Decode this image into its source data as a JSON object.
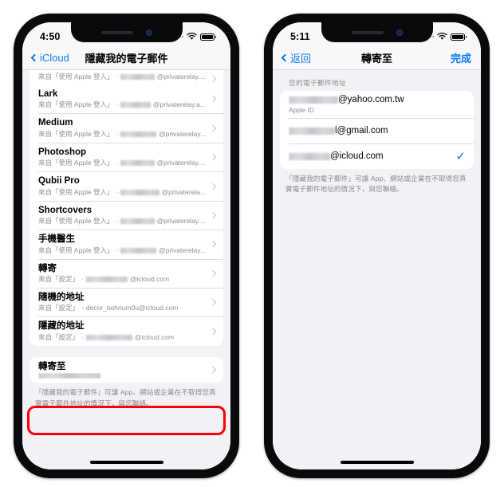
{
  "meta": {
    "accent_blue": "#0a7cff",
    "highlight_red": "#fb0007",
    "bg": "#ffffff"
  },
  "left_phone": {
    "status": {
      "time": "4:50",
      "signal": "cellular-dots-icon",
      "wifi": "wifi-icon",
      "battery": "battery-icon"
    },
    "nav": {
      "back_label": "iCloud",
      "title": "隱藏我的電子郵件"
    },
    "partial_row": {
      "sub_prefix": "來自「使用 Apple 登入」",
      "sub_sep": "·",
      "sub_domain": "@privaterelay...."
    },
    "rows": [
      {
        "title": "Lark",
        "sub_prefix": "來自「使用 Apple 登入」",
        "sub_sep": "·",
        "blur_w": 58,
        "sub_domain": "@privaterelay.a..."
      },
      {
        "title": "Medium",
        "sub_prefix": "來自「使用 Apple 登入」",
        "sub_sep": "·",
        "blur_w": 58,
        "sub_domain": "@privaterelay..."
      },
      {
        "title": "Photoshop",
        "sub_prefix": "來自「使用 Apple 登入」",
        "sub_sep": "·",
        "blur_w": 54,
        "sub_domain": "@privaterelay...."
      },
      {
        "title": "Qubii Pro",
        "sub_prefix": "來自「使用 Apple 登入」",
        "sub_sep": "·",
        "blur_w": 60,
        "sub_domain": "@privaterela..."
      },
      {
        "title": "Shortcovers",
        "sub_prefix": "來自「使用 Apple 登入」",
        "sub_sep": "·",
        "blur_w": 56,
        "sub_domain": "@privaterelay...."
      },
      {
        "title": "手機醫生",
        "sub_prefix": "來自「使用 Apple 登入」",
        "sub_sep": "·",
        "blur_w": 50,
        "sub_domain": "@privaterelay..."
      },
      {
        "title": "轉寄",
        "sub_prefix": "來自「設定」",
        "sub_sep": "·",
        "blur_w": 52,
        "sub_domain": "@icloud.com"
      },
      {
        "title": "隨機的地址",
        "sub_prefix": "來自「設定」",
        "sub_sep": "·",
        "blur_w": 0,
        "sub_domain": "decor_bohrium0u@icloud.com"
      },
      {
        "title": "隱藏的地址",
        "sub_prefix": "來自「設定」",
        "sub_sep": "·",
        "blur_w": 58,
        "sub_domain": "@icloud.com"
      }
    ],
    "highlighted_row": {
      "title": "轉寄至",
      "blur_w": 78
    },
    "footnote": "「隱藏我的電子郵件」可讓 App、網站或企業在不取得您真實電子郵件地址的情況下，與您聯絡。"
  },
  "right_phone": {
    "status": {
      "time": "5:11",
      "signal": "cellular-dots-icon",
      "wifi": "wifi-icon",
      "battery": "battery-icon"
    },
    "nav": {
      "back_label": "返回",
      "title": "轉寄至",
      "done_label": "完成"
    },
    "section_header": "您的電子郵件地址",
    "emails": [
      {
        "blur_w": 62,
        "domain": "@yahoo.com.tw",
        "sub": "Apple ID",
        "checked": false
      },
      {
        "blur_w": 58,
        "domain": "l@gmail.com",
        "sub": "",
        "checked": false
      },
      {
        "blur_w": 52,
        "domain": "@icloud.com",
        "sub": "",
        "checked": true,
        "check_glyph": "✓"
      }
    ],
    "footnote": "「隱藏我的電子郵件」可讓 App、網站或企業在不取得您真實電子郵件地址的情況下，與您聯絡。"
  }
}
